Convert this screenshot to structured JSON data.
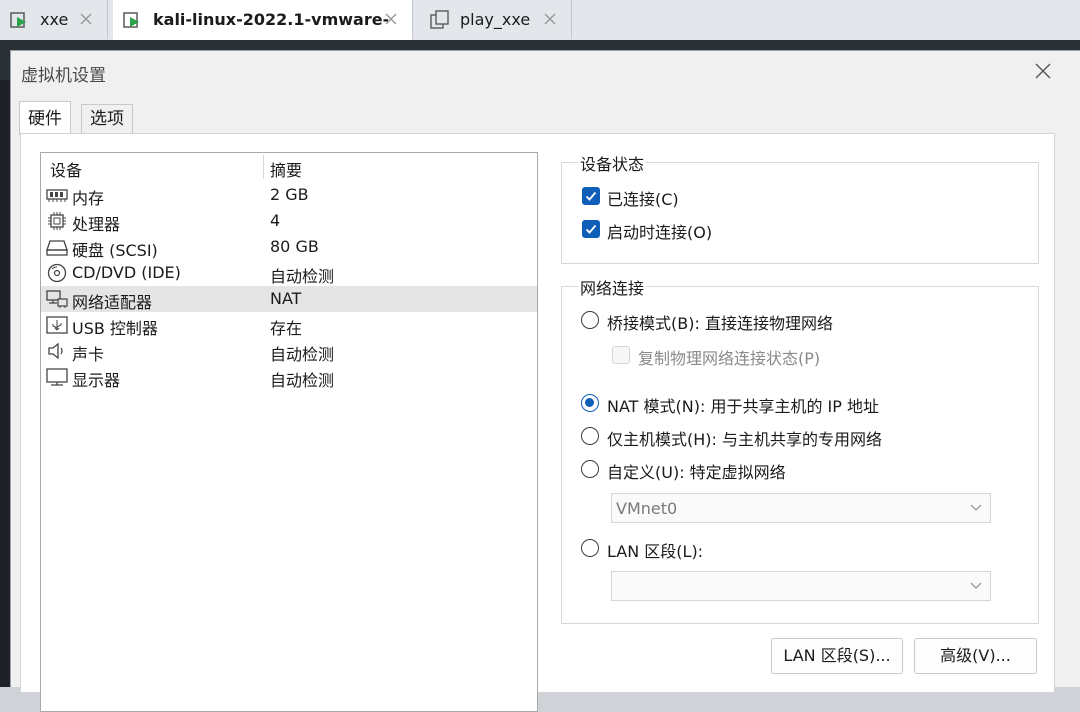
{
  "tabs": [
    {
      "label": "xxe",
      "icon": "vm-play-icon",
      "active": false
    },
    {
      "label": "kali-linux-2022.1-vmware-...",
      "icon": "vm-play-icon",
      "active": true
    },
    {
      "label": "play_xxe",
      "icon": "vm-clone-icon",
      "active": false
    }
  ],
  "dialog": {
    "title": "虚拟机设置",
    "tabs": {
      "hardware": "硬件",
      "options": "选项"
    }
  },
  "device_list": {
    "headers": {
      "device": "设备",
      "summary": "摘要"
    },
    "rows": [
      {
        "name": "内存",
        "summary": "2 GB",
        "icon": "memory-icon"
      },
      {
        "name": "处理器",
        "summary": "4",
        "icon": "processor-icon"
      },
      {
        "name": "硬盘 (SCSI)",
        "summary": "80 GB",
        "icon": "hard-disk-icon"
      },
      {
        "name": "CD/DVD (IDE)",
        "summary": "自动检测",
        "icon": "cd-dvd-icon"
      },
      {
        "name": "网络适配器",
        "summary": "NAT",
        "icon": "network-adapter-icon",
        "selected": true
      },
      {
        "name": "USB 控制器",
        "summary": "存在",
        "icon": "usb-icon"
      },
      {
        "name": "声卡",
        "summary": "自动检测",
        "icon": "sound-card-icon"
      },
      {
        "name": "显示器",
        "summary": "自动检测",
        "icon": "display-icon"
      }
    ]
  },
  "device_status": {
    "title": "设备状态",
    "connected": {
      "label": "已连接(C)",
      "checked": true
    },
    "connect_at_power_on": {
      "label": "启动时连接(O)",
      "checked": true
    }
  },
  "network": {
    "title": "网络连接",
    "bridged": {
      "label": "桥接模式(B): 直接连接物理网络",
      "selected": false
    },
    "replicate": {
      "label": "复制物理网络连接状态(P)",
      "checked": false
    },
    "nat": {
      "label": "NAT 模式(N): 用于共享主机的 IP 地址",
      "selected": true
    },
    "host_only": {
      "label": "仅主机模式(H): 与主机共享的专用网络",
      "selected": false
    },
    "custom": {
      "label": "自定义(U): 特定虚拟网络",
      "selected": false,
      "select_value": "VMnet0"
    },
    "lan_segment": {
      "label": "LAN 区段(L):",
      "selected": false,
      "select_value": ""
    }
  },
  "buttons": {
    "lan_segments": "LAN 区段(S)...",
    "advanced": "高级(V)..."
  },
  "colors": {
    "accent": "#0f5fb8",
    "selection": "#e5e5e5",
    "dialog_bg": "#f0f0f0"
  }
}
